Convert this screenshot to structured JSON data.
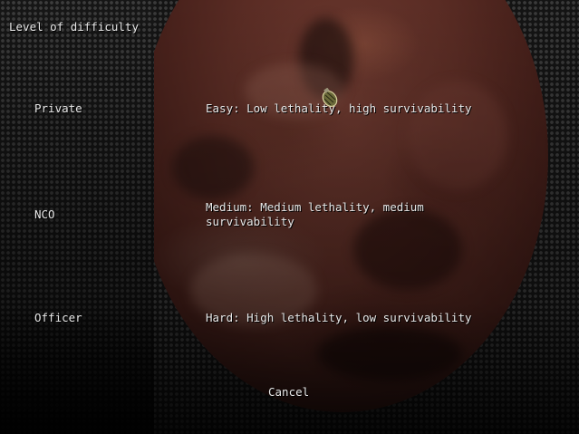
{
  "menu": {
    "title": "Level of difficulty",
    "options": [
      {
        "label": "Private",
        "description": "Easy: Low lethality, high survivability"
      },
      {
        "label": "NCO",
        "description": "Medium: Medium lethality,  medium survivability"
      },
      {
        "label": "Officer",
        "description": "Hard: High lethality,  low survivability"
      }
    ],
    "cancel_label": "Cancel"
  },
  "colors": {
    "text": "#e8e8e8",
    "photo_tint": "#5a2c24",
    "mesh": "#1a1a1a"
  },
  "icons": {
    "cursor": "grenade-cursor-icon"
  }
}
